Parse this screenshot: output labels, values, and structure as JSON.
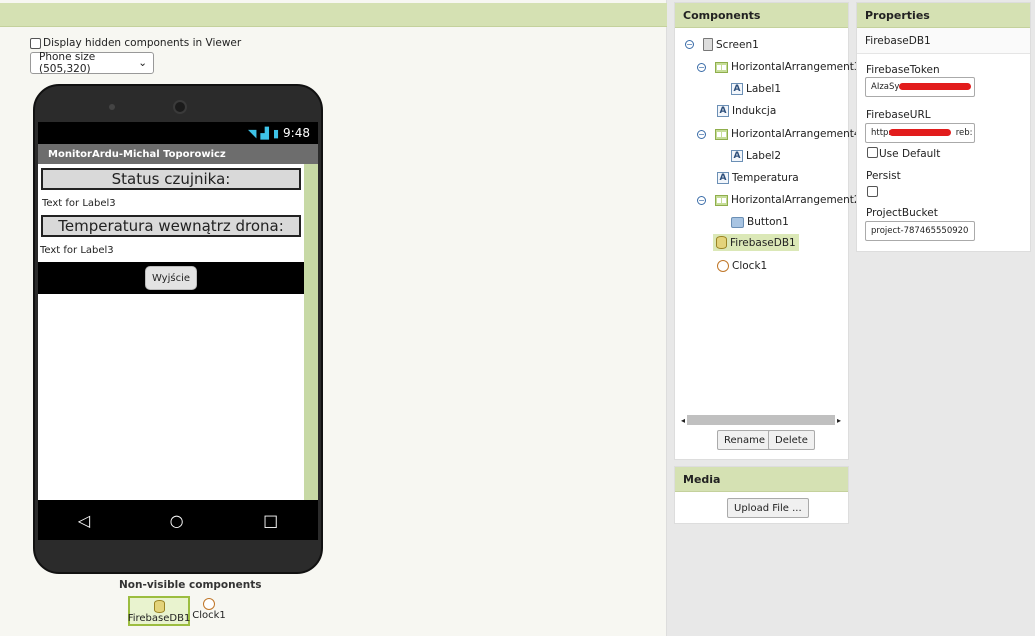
{
  "viewer": {
    "hidden_checkbox_label": "Display hidden components in Viewer",
    "phone_size": "Phone size (505,320)",
    "phone": {
      "time": "9:48",
      "app_title": "MonitorArdu-Michal Toporowicz",
      "status_label": "Status czujnika:",
      "label3_text": "Text for Label3",
      "temp_label": "Temperatura wewnątrz drona:",
      "label3b_text": "Text for Label3",
      "exit_button": "Wyjście"
    },
    "nonvisible_title": "Non-visible components",
    "nonvisible": [
      {
        "label": "FirebaseDB1",
        "icon": "database-icon",
        "selected": true
      },
      {
        "label": "Clock1",
        "icon": "clock-icon",
        "selected": false
      }
    ]
  },
  "components": {
    "header": "Components",
    "tree": [
      {
        "label": "Screen1",
        "icon": "screen-icon"
      },
      {
        "label": "HorizontalArrangement3",
        "icon": "arrangement-icon"
      },
      {
        "label": "Label1",
        "icon": "label-icon"
      },
      {
        "label": "Indukcja",
        "icon": "label-icon"
      },
      {
        "label": "HorizontalArrangement4",
        "icon": "arrangement-icon"
      },
      {
        "label": "Label2",
        "icon": "label-icon"
      },
      {
        "label": "Temperatura",
        "icon": "label-icon"
      },
      {
        "label": "HorizontalArrangement2",
        "icon": "arrangement-icon"
      },
      {
        "label": "Button1",
        "icon": "button-icon"
      },
      {
        "label": "FirebaseDB1",
        "icon": "database-icon",
        "selected": true
      },
      {
        "label": "Clock1",
        "icon": "clock-icon"
      }
    ],
    "rename_button": "Rename",
    "delete_button": "Delete"
  },
  "media": {
    "header": "Media",
    "upload_button": "Upload File ..."
  },
  "properties": {
    "header": "Properties",
    "component": "FirebaseDB1",
    "firebase_token_label": "FirebaseToken",
    "firebase_token_value": "AIzaSy",
    "firebase_url_label": "FirebaseURL",
    "firebase_url_value": "https:",
    "firebase_url_suffix": "reb:",
    "use_default_label": "Use Default",
    "persist_label": "Persist",
    "project_bucket_label": "ProjectBucket",
    "project_bucket_value": "project-787465550920"
  }
}
